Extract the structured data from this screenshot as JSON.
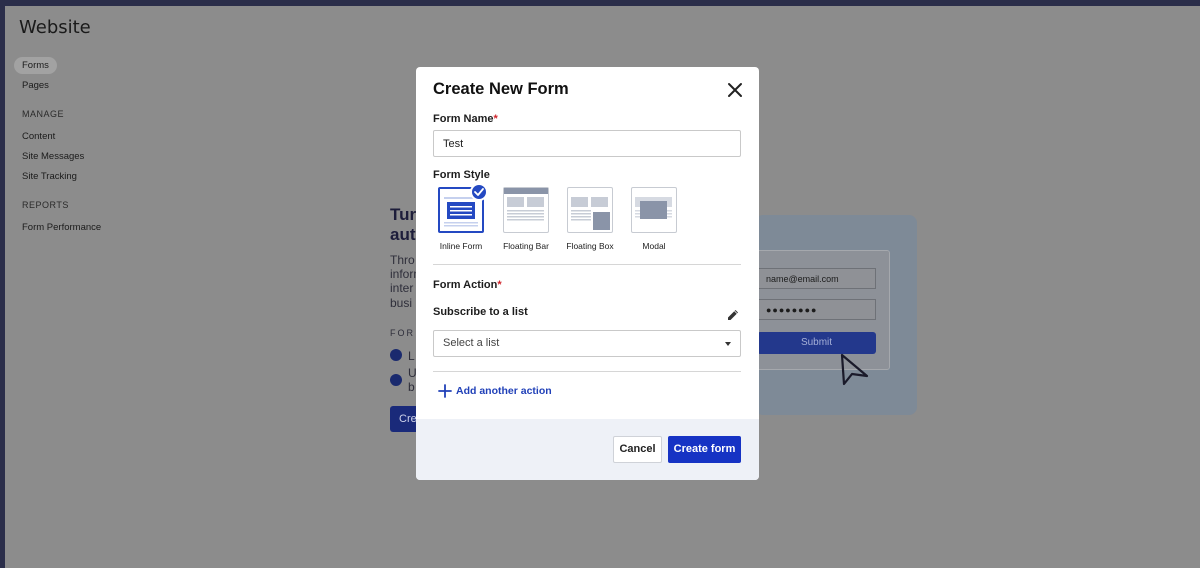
{
  "app": {
    "title": "Website"
  },
  "sidebar": {
    "items": [
      {
        "label": "Forms",
        "active": true
      },
      {
        "label": "Pages",
        "active": false
      }
    ],
    "sections": [
      {
        "title": "MANAGE",
        "items": [
          "Content",
          "Site Messages",
          "Site Tracking"
        ]
      },
      {
        "title": "REPORTS",
        "items": [
          "Form Performance"
        ]
      }
    ]
  },
  "background": {
    "heading_line1": "Tur",
    "heading_line2": "aut",
    "text_lines": [
      "Thro",
      "inform",
      "inter",
      "busi"
    ],
    "features_label": "FOR",
    "feature_1": "L",
    "feature_2a": "U",
    "feature_2b": "b",
    "create_button": "Cre",
    "preview": {
      "email_placeholder": "name@email.com",
      "password_mask": "●●●●●●●●",
      "submit_label": "Submit"
    }
  },
  "modal": {
    "title": "Create New Form",
    "form_name": {
      "label": "Form Name",
      "required_mark": "*",
      "value": "Test"
    },
    "form_style": {
      "label": "Form Style",
      "options": [
        {
          "label": "Inline Form",
          "selected": true
        },
        {
          "label": "Floating Bar",
          "selected": false
        },
        {
          "label": "Floating Box",
          "selected": false
        },
        {
          "label": "Modal",
          "selected": false
        }
      ]
    },
    "form_action": {
      "label": "Form Action",
      "required_mark": "*",
      "action_title": "Subscribe to a list",
      "select_placeholder": "Select a list"
    },
    "add_action_label": "Add another action",
    "cancel_label": "Cancel",
    "create_label": "Create form"
  },
  "colors": {
    "primary": "#1633c4",
    "accent_blue": "#2449c2",
    "required": "#d0242b",
    "overlay": "#8c8c8c"
  }
}
